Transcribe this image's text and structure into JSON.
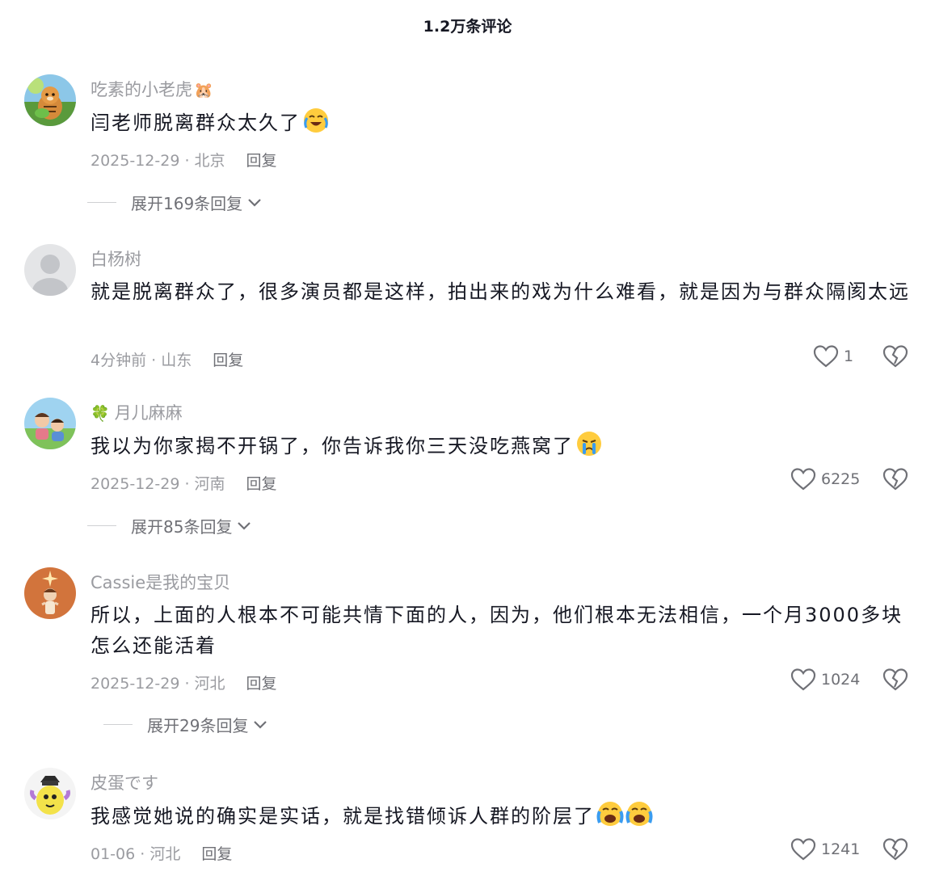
{
  "header": {
    "title": "1.2万条评论"
  },
  "comments": [
    {
      "username": "吃素的小老虎",
      "username_suffix": "🐹",
      "text": "闫老师脱离群众太久了",
      "emojis": [
        "crying-laugh"
      ],
      "date": "2025-12-29 · 北京",
      "reply_label": "回复",
      "expand_label": "展开169条回复"
    },
    {
      "username": "白杨树",
      "text": "就是脱离群众了，很多演员都是这样，拍出来的戏为什么难看，就是因为与群众隔阂太远",
      "date": "4分钟前 · 山东",
      "reply_label": "回复",
      "likes": "1"
    },
    {
      "username": "月儿麻麻",
      "username_prefix": "🍀",
      "text": "我以为你家揭不开锅了，你告诉我你三天没吃燕窝了",
      "emojis": [
        "crying"
      ],
      "date": "2025-12-29 · 河南",
      "reply_label": "回复",
      "likes": "6225",
      "expand_label": "展开85条回复"
    },
    {
      "username": "Cassie是我的宝贝",
      "text": "所以，上面的人根本不可能共情下面的人，因为，他们根本无法相信，一个月3000多块怎么还能活着",
      "date": "2025-12-29 · 河北",
      "reply_label": "回复",
      "likes": "1024",
      "expand_label": "展开29条回复"
    },
    {
      "username": "皮蛋です",
      "text": "我感觉她说的确实是实话，就是找错倾诉人群的阶层了",
      "emojis": [
        "loud-cry",
        "loud-cry"
      ],
      "date": "01-06 · 河北",
      "reply_label": "回复",
      "likes": "1241"
    }
  ],
  "icons": {
    "like": "heart-outline-icon",
    "dislike": "broken-heart-icon",
    "expand": "chevron-down-icon"
  },
  "colors": {
    "text": "#161823",
    "muted": "#9a9ba0",
    "secondary": "#6f7076",
    "emoji_yellow": "#ffcc3e",
    "tear_blue": "#3a9cf0"
  }
}
